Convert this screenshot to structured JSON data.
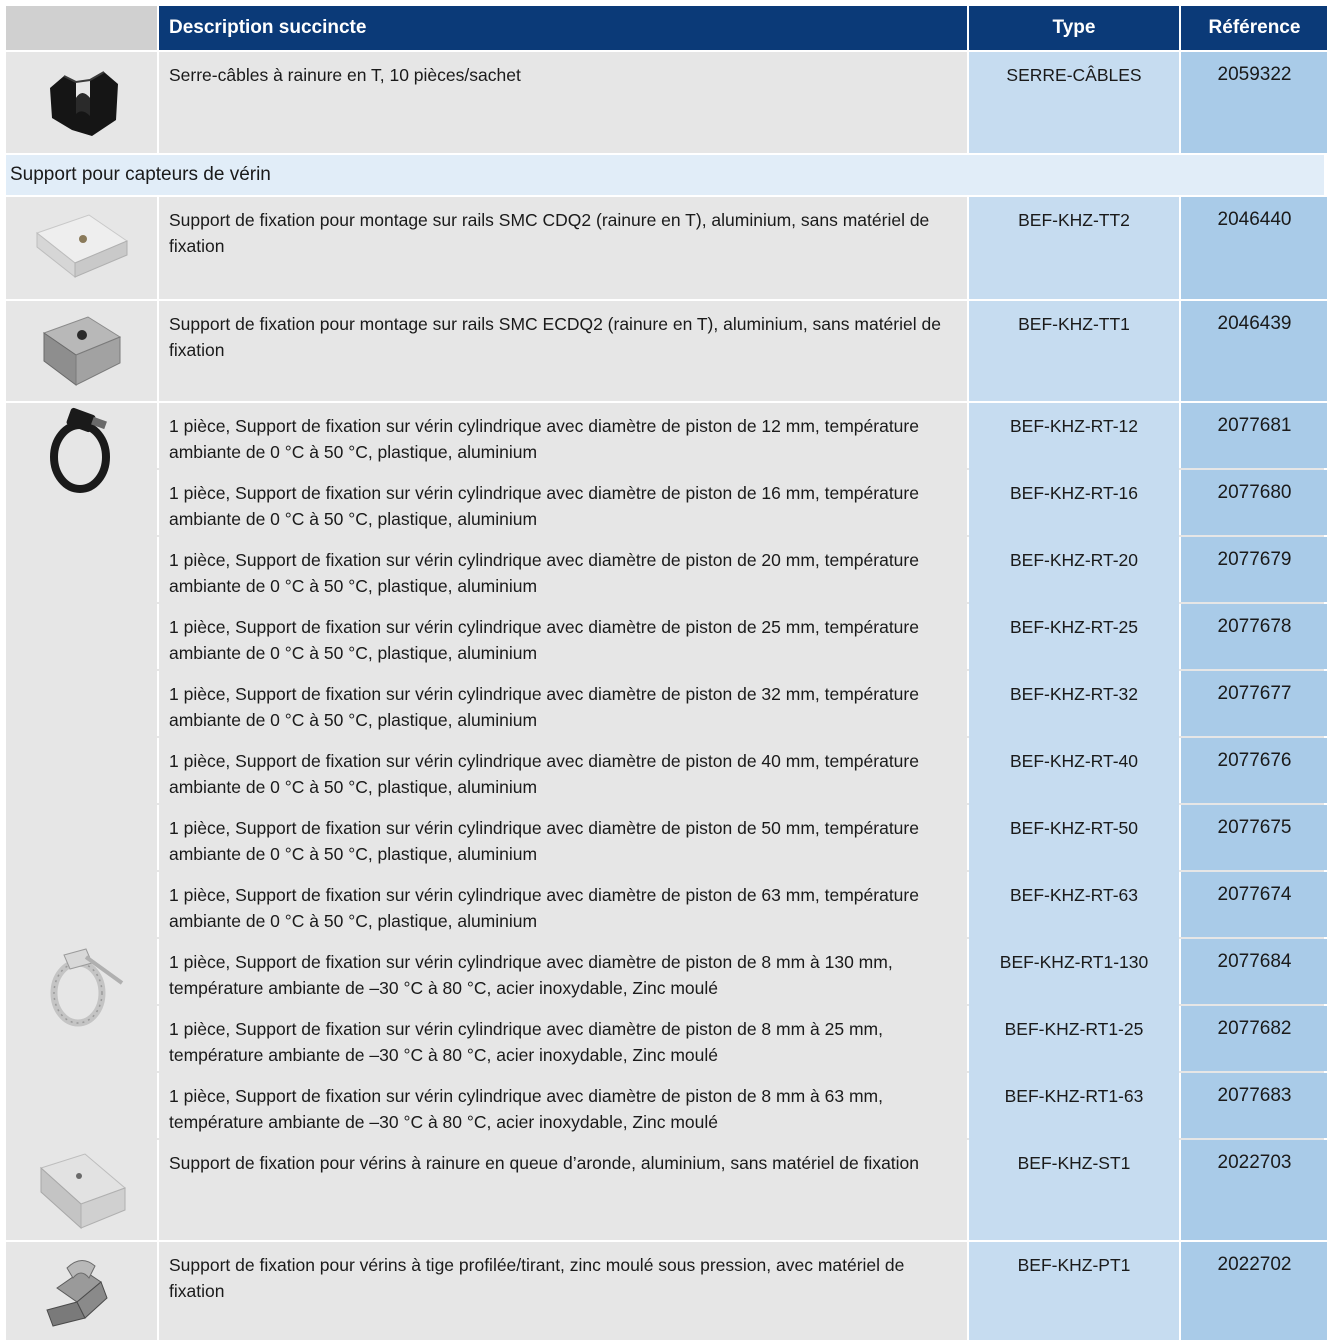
{
  "header": {
    "description": "Description succincte",
    "type": "Type",
    "reference": "Référence"
  },
  "section_title": "Support pour capteurs de vérin",
  "rows": [
    {
      "description": "Serre-câbles à rainure en T, 10 pièces/sachet",
      "type": "SERRE-CÂBLES",
      "reference": "2059322",
      "icon": "cable-clip-icon"
    },
    {
      "description": "Support de fixation pour montage sur rails SMC CDQ2 (rainure en T), aluminium, sans matériel de fixation",
      "type": "BEF-KHZ-TT2",
      "reference": "2046440",
      "icon": "rail-bracket-icon"
    },
    {
      "description": "Support de fixation pour montage sur rails SMC ECDQ2 (rainure en T), aluminium, sans matériel de fixation",
      "type": "BEF-KHZ-TT1",
      "reference": "2046439",
      "icon": "rail-bracket-dark-icon"
    },
    {
      "description": "1 pièce, Support de fixation sur vérin cylindrique avec diamètre de piston de 12 mm, température ambiante de 0 °C à 50 °C, plastique, aluminium",
      "type": "BEF-KHZ-RT-12",
      "reference": "2077681",
      "icon": "strap-clamp-icon"
    },
    {
      "description": "1 pièce, Support de fixation sur vérin cylindrique avec diamètre de piston de 16 mm, température ambiante de 0 °C à 50 °C, plastique, aluminium",
      "type": "BEF-KHZ-RT-16",
      "reference": "2077680"
    },
    {
      "description": "1 pièce, Support de fixation sur vérin cylindrique avec diamètre de piston de 20 mm, température ambiante de 0 °C à 50 °C, plastique, aluminium",
      "type": "BEF-KHZ-RT-20",
      "reference": "2077679"
    },
    {
      "description": "1 pièce, Support de fixation sur vérin cylindrique avec diamètre de piston de 25 mm, température ambiante de 0 °C à 50 °C, plastique, aluminium",
      "type": "BEF-KHZ-RT-25",
      "reference": "2077678"
    },
    {
      "description": "1 pièce, Support de fixation sur vérin cylindrique avec diamètre de piston de 32 mm, température ambiante de 0 °C à 50 °C, plastique, aluminium",
      "type": "BEF-KHZ-RT-32",
      "reference": "2077677"
    },
    {
      "description": "1 pièce, Support de fixation sur vérin cylindrique avec diamètre de piston de 40 mm, température ambiante de 0 °C à 50 °C, plastique, aluminium",
      "type": "BEF-KHZ-RT-40",
      "reference": "2077676"
    },
    {
      "description": "1 pièce, Support de fixation sur vérin cylindrique avec diamètre de piston de 50 mm, température ambiante de 0 °C à 50 °C, plastique, aluminium",
      "type": "BEF-KHZ-RT-50",
      "reference": "2077675"
    },
    {
      "description": "1 pièce, Support de fixation sur vérin cylindrique avec diamètre de piston de 63 mm, température ambiante de 0 °C à 50 °C, plastique, aluminium",
      "type": "BEF-KHZ-RT-63",
      "reference": "2077674"
    },
    {
      "description": "1 pièce, Support de fixation sur vérin cylindrique avec diamètre de piston de 8 mm à 130 mm, température ambiante de –30 °C à 80 °C, acier inoxydable, Zinc moulé",
      "type": "BEF-KHZ-RT1-130",
      "reference": "2077684",
      "icon": "hose-clamp-icon"
    },
    {
      "description": "1 pièce, Support de fixation sur vérin cylindrique avec diamètre de piston de 8 mm à 25 mm, température ambiante de –30 °C à 80 °C, acier inoxydable, Zinc moulé",
      "type": "BEF-KHZ-RT1-25",
      "reference": "2077682"
    },
    {
      "description": "1 pièce, Support de fixation sur vérin cylindrique avec diamètre de piston de 8 mm à 63 mm, température ambiante de –30 °C à 80 °C, acier inoxydable, Zinc moulé",
      "type": "BEF-KHZ-RT1-63",
      "reference": "2077683"
    },
    {
      "description": "Support de fixation pour vérins à rainure en queue d’aronde, aluminium, sans matériel de fixation",
      "type": "BEF-KHZ-ST1",
      "reference": "2022703",
      "icon": "dovetail-bracket-icon"
    },
    {
      "description": "Support de fixation pour vérins à tige profilée/tirant, zinc moulé sous pression, avec matériel de fixation",
      "type": "BEF-KHZ-PT1",
      "reference": "2022702",
      "icon": "tie-rod-bracket-icon"
    }
  ]
}
